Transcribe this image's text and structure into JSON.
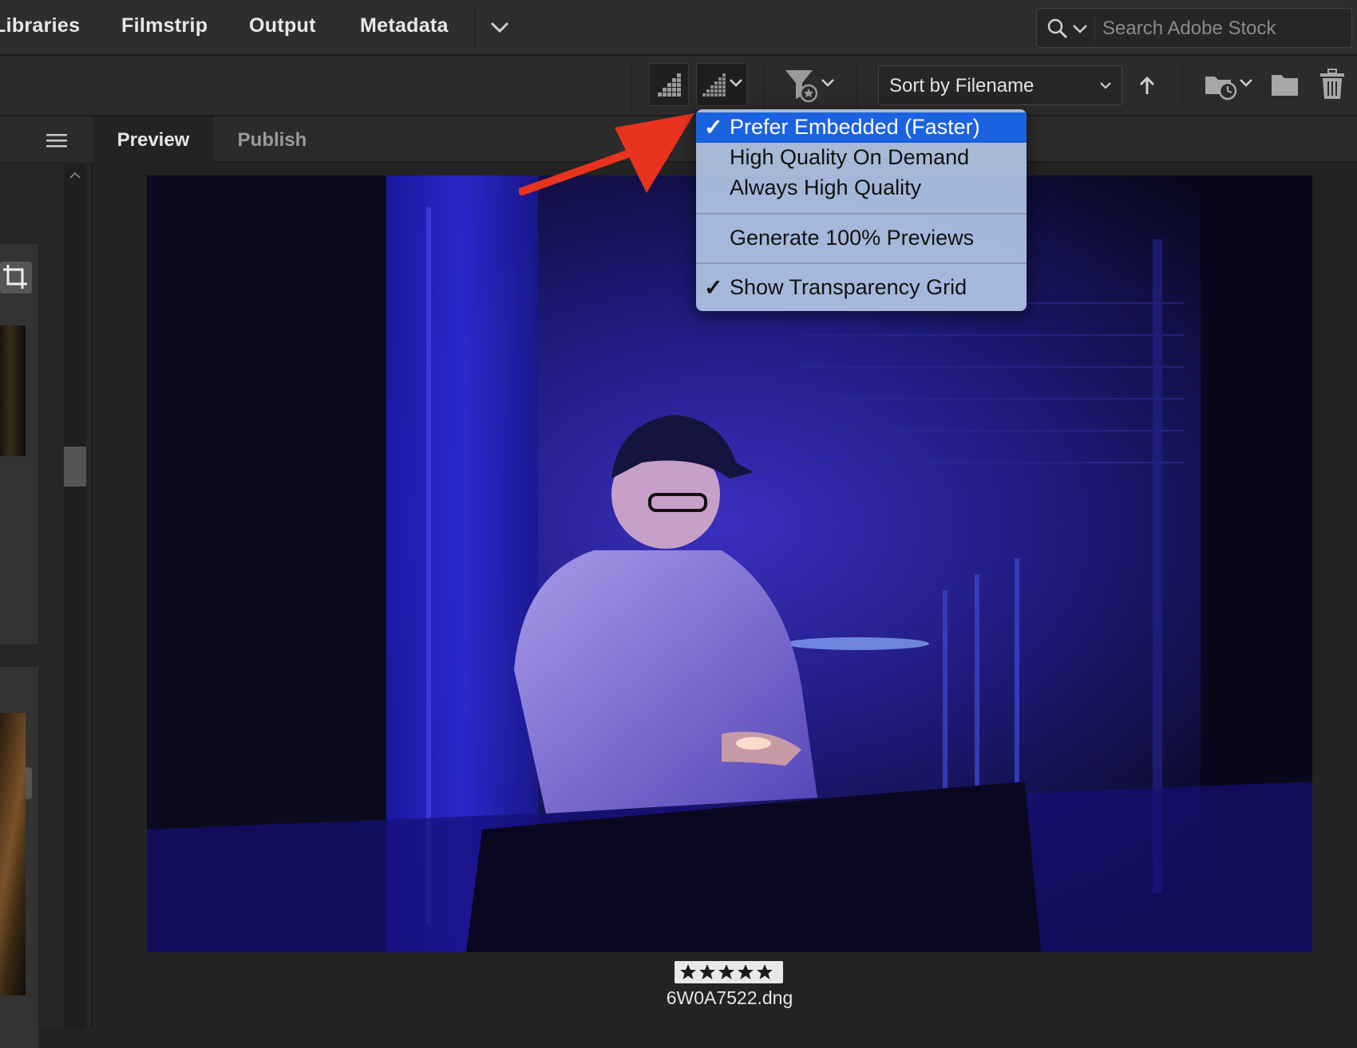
{
  "workspace_tabs": [
    "Libraries",
    "Filmstrip",
    "Output",
    "Metadata"
  ],
  "search": {
    "placeholder": "Search Adobe Stock",
    "value": ""
  },
  "toolbar": {
    "sort_label": "Sort by Filename"
  },
  "content_tabs": [
    "Preview",
    "Publish"
  ],
  "preview": {
    "filename": "6W0A7522.dng",
    "rating_stars": 5
  },
  "quality_menu": {
    "items": [
      {
        "label": "Prefer Embedded (Faster)",
        "checked": true,
        "highlighted": true
      },
      {
        "label": "High Quality On Demand",
        "checked": false
      },
      {
        "label": "Always High Quality",
        "checked": false
      },
      {
        "label": "Generate 100% Previews",
        "checked": false
      },
      {
        "label": "Show Transparency Grid",
        "checked": true
      }
    ]
  },
  "colors": {
    "menu_highlight": "#1b62e0",
    "annotation_arrow": "#e8331f",
    "panel_bg": "#2b2b2b"
  },
  "icons": [
    "search-icon",
    "chevron-down-icon",
    "quality-icon",
    "filter-star-icon",
    "sort-arrow-up-icon",
    "new-folder-recent-icon",
    "folder-icon",
    "trash-icon",
    "hamburger-icon",
    "crop-icon",
    "adjust-sliders-icon"
  ]
}
